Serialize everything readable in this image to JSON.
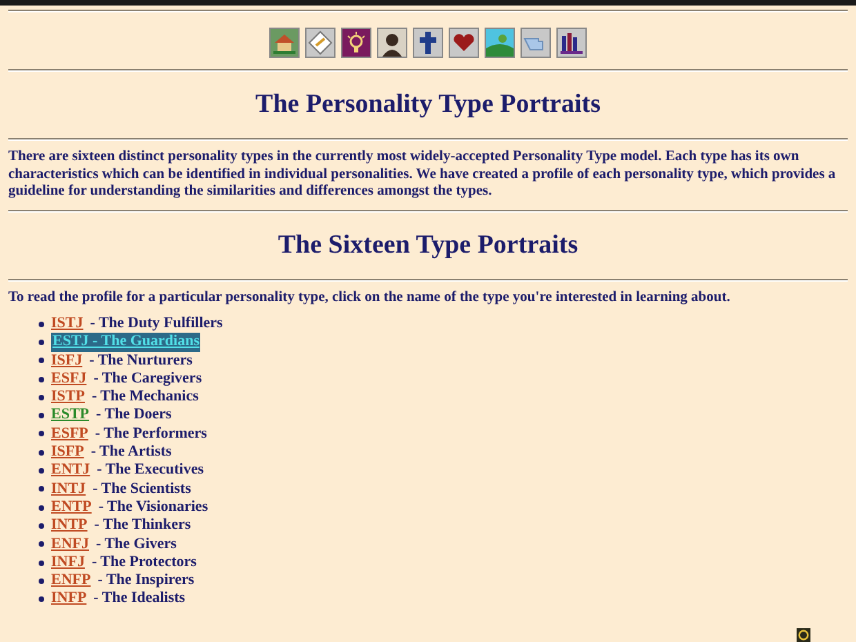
{
  "title": "The Personality Type Portraits",
  "intro": "There are sixteen distinct personality types in the currently most widely-accepted Personality Type model. Each type has its own characteristics which can be identified in individual personalities. We have created a profile of each personality type, which provides a guideline for understanding the similarities and differences amongst the types.",
  "subtitle": "The Sixteen Type Portraits",
  "instruction": "To read the profile for a particular personality type, click on the name of the type you're interested in learning about.",
  "types": [
    {
      "code": "ISTJ",
      "name": "- The Duty Fulfillers",
      "selected": false,
      "color": "#c04a22"
    },
    {
      "code": "ESTJ",
      "name": "- The Guardians",
      "selected": true
    },
    {
      "code": "ISFJ",
      "name": "- The Nurturers",
      "selected": false,
      "color": "#c04a22"
    },
    {
      "code": "ESFJ",
      "name": "- The Caregivers",
      "selected": false,
      "color": "#c04a22"
    },
    {
      "code": "ISTP",
      "name": "- The Mechanics",
      "selected": false,
      "color": "#c04a22"
    },
    {
      "code": "ESTP",
      "name": "- The Doers",
      "selected": false,
      "color": "#2a8a2a"
    },
    {
      "code": "ESFP",
      "name": "- The Performers",
      "selected": false,
      "color": "#c04a22"
    },
    {
      "code": "ISFP",
      "name": "- The Artists",
      "selected": false,
      "color": "#c04a22"
    },
    {
      "code": "ENTJ",
      "name": "- The Executives",
      "selected": false,
      "color": "#c04a22"
    },
    {
      "code": "INTJ",
      "name": "- The Scientists",
      "selected": false,
      "color": "#c04a22"
    },
    {
      "code": "ENTP",
      "name": "- The Visionaries",
      "selected": false,
      "color": "#c04a22"
    },
    {
      "code": "INTP",
      "name": "- The Thinkers",
      "selected": false,
      "color": "#c04a22"
    },
    {
      "code": "ENFJ",
      "name": "- The Givers",
      "selected": false,
      "color": "#c04a22"
    },
    {
      "code": "INFJ",
      "name": "- The Protectors",
      "selected": false,
      "color": "#c04a22"
    },
    {
      "code": "ENFP",
      "name": "- The Inspirers",
      "selected": false,
      "color": "#c04a22"
    },
    {
      "code": "INFP",
      "name": "- The Idealists",
      "selected": false,
      "color": "#c04a22"
    }
  ]
}
